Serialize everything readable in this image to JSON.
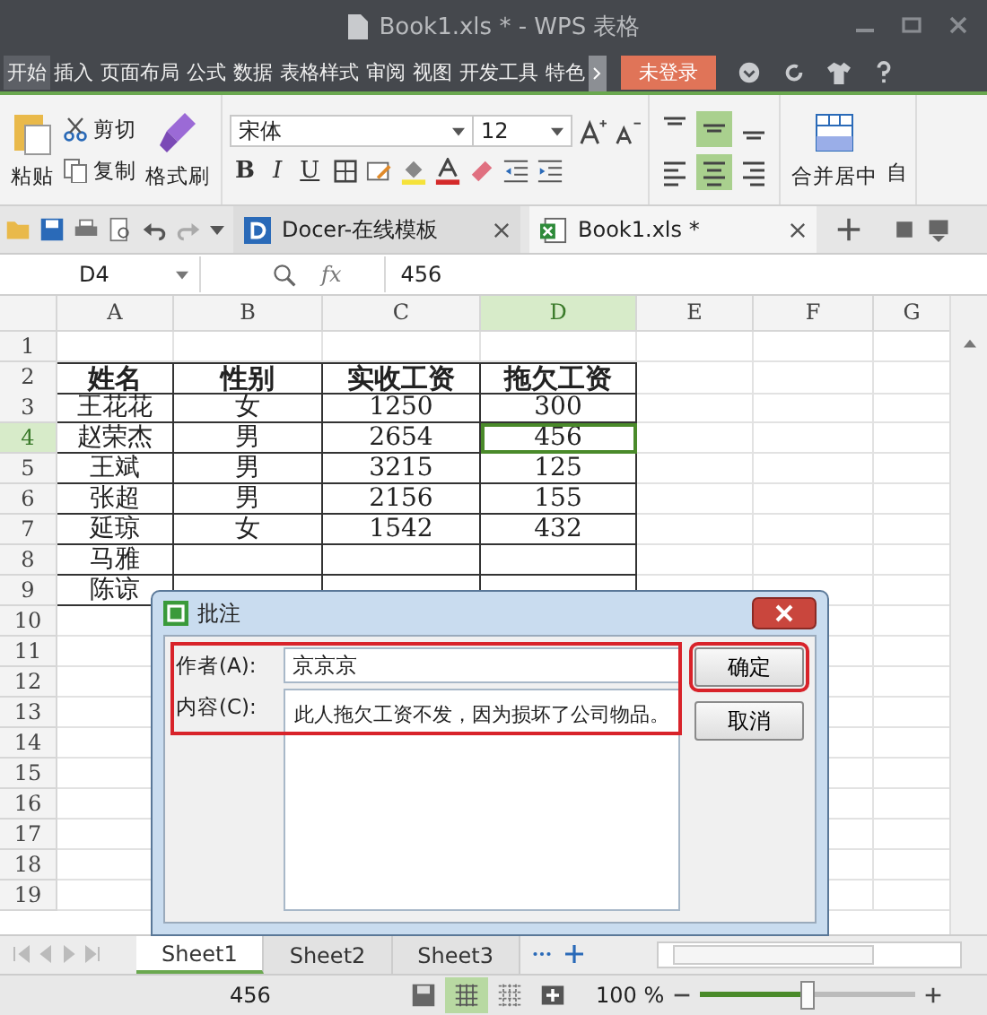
{
  "window": {
    "title": "Book1.xls * - WPS 表格"
  },
  "menu": {
    "items": [
      {
        "label": "开始",
        "selected": true
      },
      {
        "label": "插入",
        "selected": false
      },
      {
        "label": "页面布局",
        "selected": false
      },
      {
        "label": "公式",
        "selected": false
      },
      {
        "label": "数据",
        "selected": false
      },
      {
        "label": "表格样式",
        "selected": false
      },
      {
        "label": "审阅",
        "selected": false
      },
      {
        "label": "视图",
        "selected": false
      },
      {
        "label": "开发工具",
        "selected": false
      },
      {
        "label": "特色",
        "selected": false
      }
    ],
    "login": "未登录"
  },
  "ribbon": {
    "paste": "粘贴",
    "cut": "剪切",
    "copy": "复制",
    "format_painter": "格式刷",
    "font": "宋体",
    "size": "12",
    "bold": "B",
    "italic": "I",
    "underline": "U",
    "vertical_align": [
      {
        "selected": false
      },
      {
        "selected": true
      },
      {
        "selected": false
      }
    ],
    "horizontal_align": [
      {
        "selected": false
      },
      {
        "selected": true
      },
      {
        "selected": false
      }
    ],
    "merge": "合并居中",
    "cut_off_label": "自"
  },
  "doc_tabs": [
    {
      "label": "Docer-在线模板",
      "kind": "docer",
      "selected": false
    },
    {
      "label": "Book1.xls *",
      "kind": "sheet",
      "selected": true
    }
  ],
  "formula_bar": {
    "cell": "D4",
    "fx": "fx",
    "value": "456"
  },
  "grid": {
    "columns": [
      {
        "label": "A",
        "selected": false
      },
      {
        "label": "B",
        "selected": false
      },
      {
        "label": "C",
        "selected": false
      },
      {
        "label": "D",
        "selected": true
      },
      {
        "label": "E",
        "selected": false
      },
      {
        "label": "F",
        "selected": false
      },
      {
        "label": "G",
        "selected": false
      }
    ],
    "rows": [
      {
        "label": "1",
        "kind": "empty",
        "selected": false,
        "cells": []
      },
      {
        "label": "2",
        "kind": "header",
        "selected": false,
        "cells": [
          "姓名",
          "性别",
          "实收工资",
          "拖欠工资"
        ]
      },
      {
        "label": "3",
        "kind": "data",
        "selected": false,
        "cells": [
          "王花花",
          "女",
          "1250",
          "300"
        ]
      },
      {
        "label": "4",
        "kind": "data",
        "selected": true,
        "cells": [
          "赵荣杰",
          "男",
          "2654",
          "456"
        ]
      },
      {
        "label": "5",
        "kind": "data",
        "selected": false,
        "cells": [
          "王斌",
          "男",
          "3215",
          "125"
        ]
      },
      {
        "label": "6",
        "kind": "data",
        "selected": false,
        "cells": [
          "张超",
          "男",
          "2156",
          "155"
        ]
      },
      {
        "label": "7",
        "kind": "data",
        "selected": false,
        "cells": [
          "延琼",
          "女",
          "1542",
          "432"
        ]
      },
      {
        "label": "8",
        "kind": "data",
        "selected": false,
        "cells": [
          "马雅"
        ]
      },
      {
        "label": "9",
        "kind": "data",
        "selected": false,
        "cells": [
          "陈谅"
        ]
      },
      {
        "label": "10",
        "kind": "empty",
        "selected": false,
        "cells": []
      },
      {
        "label": "11",
        "kind": "empty",
        "selected": false,
        "cells": []
      },
      {
        "label": "12",
        "kind": "empty",
        "selected": false,
        "cells": []
      },
      {
        "label": "13",
        "kind": "empty",
        "selected": false,
        "cells": []
      },
      {
        "label": "14",
        "kind": "empty",
        "selected": false,
        "cells": []
      },
      {
        "label": "15",
        "kind": "empty",
        "selected": false,
        "cells": []
      },
      {
        "label": "16",
        "kind": "empty",
        "selected": false,
        "cells": []
      },
      {
        "label": "17",
        "kind": "empty",
        "selected": false,
        "cells": []
      },
      {
        "label": "18",
        "kind": "empty",
        "selected": false,
        "cells": []
      },
      {
        "label": "19",
        "kind": "empty",
        "selected": false,
        "cells": []
      }
    ]
  },
  "sheet_tabs": [
    {
      "label": "Sheet1",
      "selected": true
    },
    {
      "label": "Sheet2",
      "selected": false
    },
    {
      "label": "Sheet3",
      "selected": false
    }
  ],
  "status_bar": {
    "value": "456",
    "zoom": "100 %",
    "zoom_slider": {
      "level": 0.5
    }
  },
  "dialog": {
    "title": "批注",
    "author_label": "作者(A):",
    "author": "京京京",
    "content_label": "内容(C):",
    "content": "此人拖欠工资不发，因为损坏了公司物品。",
    "buttons": [
      "确定",
      "取消"
    ]
  }
}
